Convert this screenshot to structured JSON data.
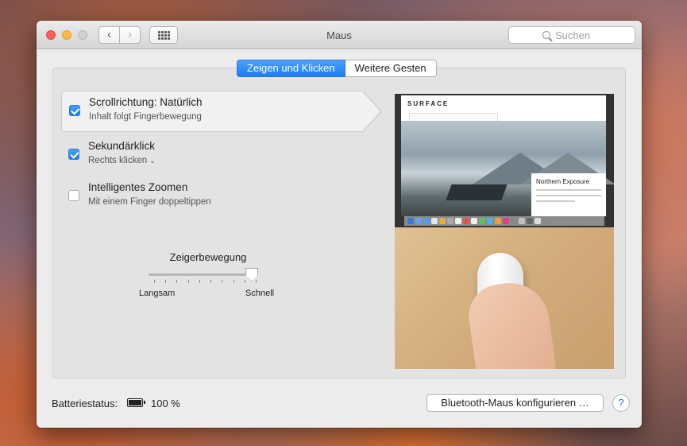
{
  "window": {
    "title": "Maus",
    "search_placeholder": "Suchen"
  },
  "tabs": [
    {
      "label": "Zeigen und Klicken",
      "active": true
    },
    {
      "label": "Weitere Gesten",
      "active": false
    }
  ],
  "options": [
    {
      "title": "Scrollrichtung: Natürlich",
      "subtitle": "Inhalt folgt Fingerbewegung",
      "checked": true,
      "selected": true
    },
    {
      "title": "Sekundärklick",
      "subtitle": "Rechts klicken",
      "checked": true,
      "selected": false,
      "has_dropdown": true
    },
    {
      "title": "Intelligentes Zoomen",
      "subtitle": "Mit einem Finger doppeltippen",
      "checked": false,
      "selected": false
    }
  ],
  "tracking": {
    "label": "Zeigerbewegung",
    "min_label": "Langsam",
    "max_label": "Schnell",
    "value_fraction": 1.0,
    "ticks": 10
  },
  "preview": {
    "site_logo": "SURFACE",
    "card_title": "Northern Exposure"
  },
  "footer": {
    "battery_label": "Batteriestatus:",
    "battery_percent": "100 %",
    "bluetooth_button": "Bluetooth-Maus konfigurieren …",
    "help_label": "?"
  },
  "colors": {
    "accent": "#1b7cf5",
    "close": "#fc605b",
    "minimize": "#fdbc40"
  }
}
